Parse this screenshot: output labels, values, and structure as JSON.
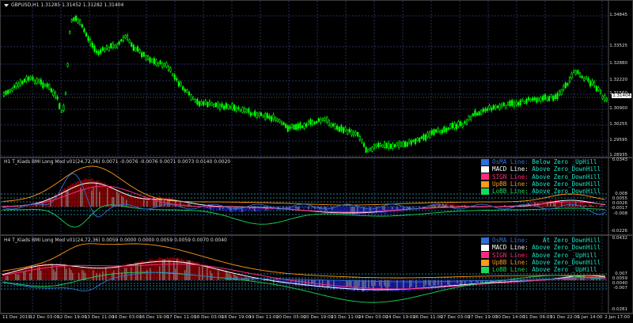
{
  "main": {
    "caption": "GBPUSD,H1  1.31285 1.31452 1.31282 1.31404",
    "price_labels": [
      "1.34845",
      "1.33525",
      "1.32880",
      "1.32220",
      "1.31560",
      "1.30900",
      "1.30255",
      "1.29595",
      "1.28935"
    ],
    "current_price": "1.31404"
  },
  "ind1": {
    "caption": "H1 T_Kiads BMI Long Mod v01(24,72,36) 0.0071 -0.0076 -0.0076 0.0071 0.0073 0.0140 0.0020",
    "axis_labels": [
      "0.0343",
      "0.008",
      "0.0055",
      "0.0026",
      "-0.0017",
      "-0.008",
      "-0.0226"
    ],
    "legend": [
      {
        "swatch": "#2f6fd6",
        "name": "OsMA Line:",
        "name_color": "#2f6fd6",
        "state": "Below Zero _UpHill",
        "state_color": "#18e6c8"
      },
      {
        "swatch": "#ffffff",
        "name": "MACD Line:",
        "name_color": "#ffffff",
        "state": "Above Zero_DownHill",
        "state_color": "#18e6c8"
      },
      {
        "swatch": "#ff2a7f",
        "name": "SIGN Line:",
        "name_color": "#ff2a7f",
        "state": "Above Zero_DownHill",
        "state_color": "#18e6c8"
      },
      {
        "swatch": "#ff9a1a",
        "name": "UpBB Line:",
        "name_color": "#ff9a1a",
        "state": "Above Zero_DownHill",
        "state_color": "#18e6c8"
      },
      {
        "swatch": "#18d85a",
        "name": "LoBB Line:",
        "name_color": "#18d85a",
        "state": "Above Zero_DownHill",
        "state_color": "#18e6c8"
      }
    ]
  },
  "ind2": {
    "caption": "H4 T_Kiads BMI Long Mod v01(24,72,36) 0.0059 0.0000 0.0000 0.0059 0.0059 0.0070 0.0040",
    "axis_labels": [
      "0.0432",
      "0.007",
      "0.0059",
      "0.0040",
      "-0.007",
      "-0.0281"
    ],
    "legend": [
      {
        "swatch": "#2f6fd6",
        "name": "OsMA Line:",
        "name_color": "#2f6fd6",
        "state": "   At Zero_DownHill",
        "state_color": "#18e6c8"
      },
      {
        "swatch": "#ffffff",
        "name": "MACD Line:",
        "name_color": "#ffffff",
        "state": "Above Zero_DownHill",
        "state_color": "#18e6c8"
      },
      {
        "swatch": "#ff2a7f",
        "name": "SIGN Line:",
        "name_color": "#ff2a7f",
        "state": "Above Zero _UpHill",
        "state_color": "#18e6c8"
      },
      {
        "swatch": "#ff9a1a",
        "name": "UpBB Line:",
        "name_color": "#ff9a1a",
        "state": "Above Zero_DownHill",
        "state_color": "#18e6c8"
      },
      {
        "swatch": "#18d85a",
        "name": "LoBB Line:",
        "name_color": "#18d85a",
        "state": "Above Zero _UpHill",
        "state_color": "#18e6c8"
      }
    ]
  },
  "time_labels": [
    "11 Dec 2019",
    "12 Dec 03:00",
    "12 Dec 19:00",
    "13 Dec 11:00",
    "16 Dec 03:00",
    "16 Dec 19:00",
    "17 Dec 11:00",
    "18 Dec 03:00",
    "18 Dec 19:00",
    "19 Dec 11:00",
    "20 Dec 03:00",
    "20 Dec 19:00",
    "23 Dec 11:00",
    "24 Dec 03:00",
    "24 Dec 19:00",
    "26 Dec 11:00",
    "27 Dec 03:00",
    "27 Dec 19:00",
    "30 Dec 14:00",
    "31 Dec 06:00",
    "31 Dec 22:00",
    "1 Jan 14:00",
    "2 Jan 17:00"
  ],
  "colors": {
    "candle": "#00ff00",
    "grid": "#26305e",
    "osma_pos": "#8b0000",
    "osma_neg": "#1a1aa8",
    "macd_hist": "#b8b8b8"
  }
}
